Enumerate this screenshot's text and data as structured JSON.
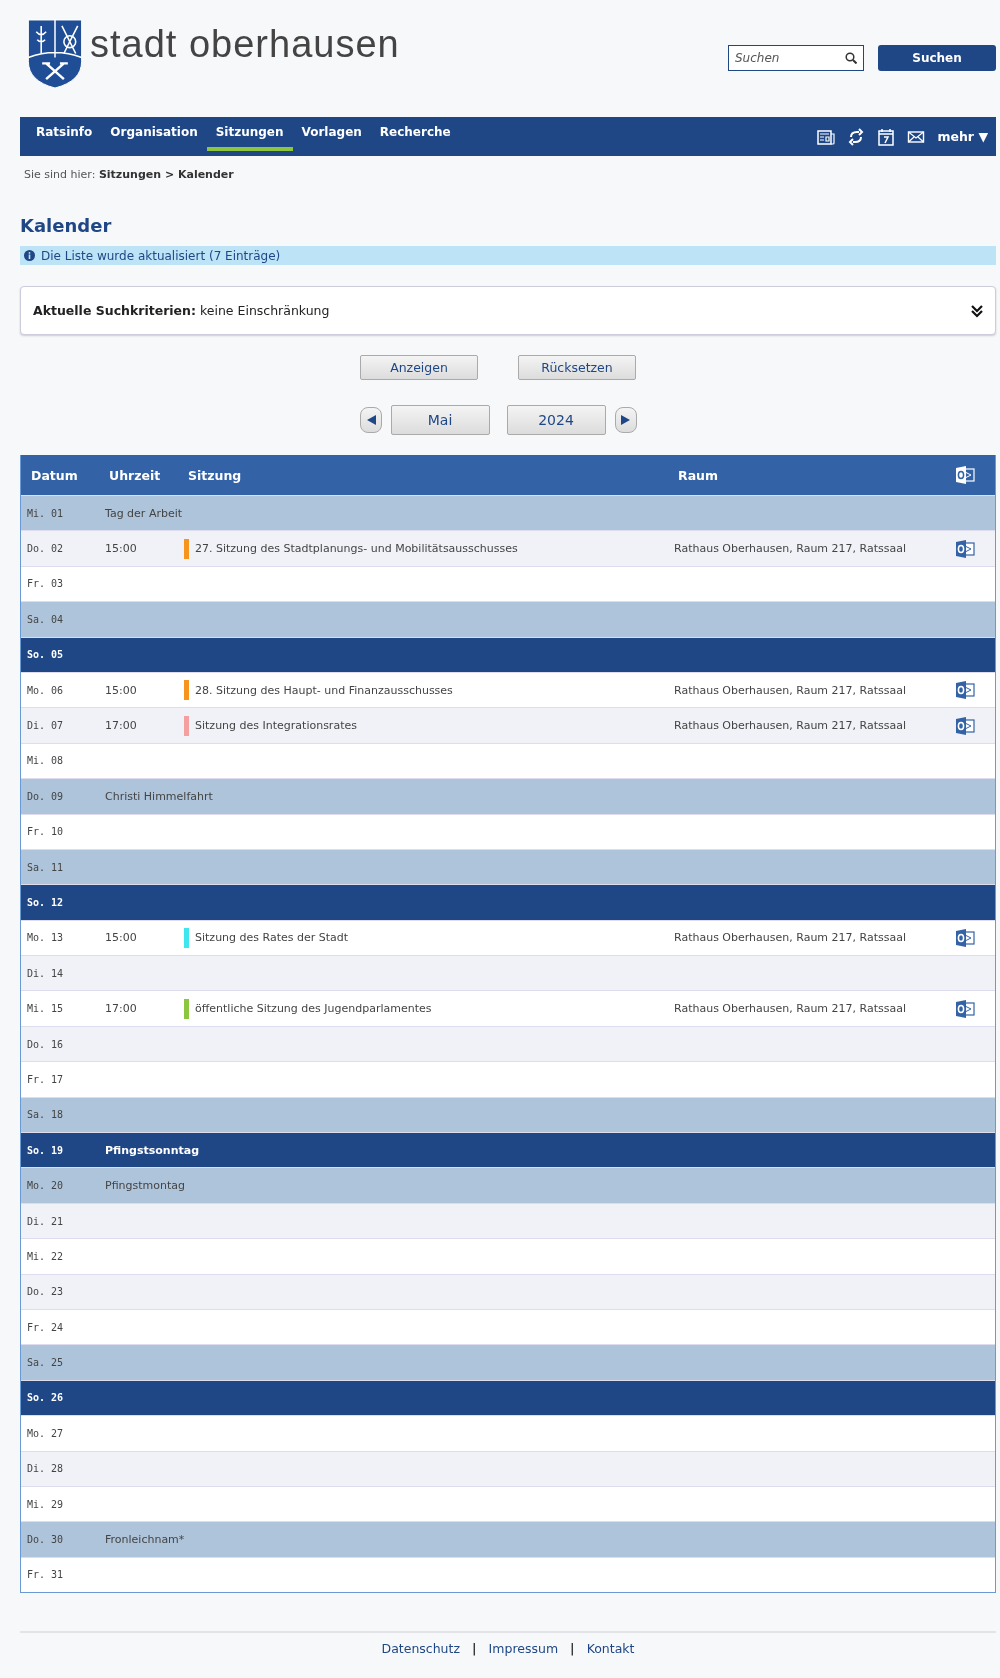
{
  "header": {
    "logo_text": "stadt oberhausen",
    "search": {
      "placeholder": "Suchen"
    },
    "search_button": "Suchen"
  },
  "nav": {
    "tabs": [
      {
        "label": "Ratsinfo",
        "selected": false
      },
      {
        "label": "Organisation",
        "selected": false
      },
      {
        "label": "Sitzungen",
        "selected": true
      },
      {
        "label": "Vorlagen",
        "selected": false
      },
      {
        "label": "Recherche",
        "selected": false
      }
    ],
    "more": "mehr ▼"
  },
  "breadcrumb": {
    "prefix": "Sie sind hier:",
    "path": "Sitzungen > Kalender"
  },
  "title": "Kalender",
  "notice": "Die Liste wurde aktualisiert (7 Einträge)",
  "criteria": {
    "label": "Aktuelle Suchkriterien:",
    "value": "keine Einschränkung"
  },
  "buttons": [
    "Anzeigen",
    "Rücksetzen"
  ],
  "period": {
    "month": "Mai",
    "year": "2024"
  },
  "table": {
    "columns": [
      "Datum",
      "Uhrzeit",
      "Sitzung",
      "Raum"
    ],
    "rows": [
      {
        "date": "Mi. 01",
        "kind": "holiday",
        "note": "Tag der Arbeit"
      },
      {
        "date": "Do. 02",
        "kind": "alt",
        "time": "15:00",
        "title": "27. Sitzung des Stadtplanungs- und Mobilitätsausschusses",
        "color": "#f7941d",
        "room": "Rathaus Oberhausen, Raum 217, Ratssaal"
      },
      {
        "date": "Fr. 03",
        "kind": "plain"
      },
      {
        "date": "Sa. 04",
        "kind": "holiday"
      },
      {
        "date": "So. 05",
        "kind": "sunday"
      },
      {
        "date": "Mo. 06",
        "kind": "plain",
        "time": "15:00",
        "title": "28. Sitzung des Haupt- und Finanzausschusses",
        "color": "#f7941d",
        "room": "Rathaus Oberhausen, Raum 217, Ratssaal"
      },
      {
        "date": "Di. 07",
        "kind": "alt",
        "time": "17:00",
        "title": "Sitzung des Integrationsrates",
        "color": "#f4a0a0",
        "room": "Rathaus Oberhausen, Raum 217, Ratssaal"
      },
      {
        "date": "Mi. 08",
        "kind": "plain"
      },
      {
        "date": "Do. 09",
        "kind": "holiday",
        "note": "Christi Himmelfahrt"
      },
      {
        "date": "Fr. 10",
        "kind": "plain"
      },
      {
        "date": "Sa. 11",
        "kind": "holiday"
      },
      {
        "date": "So. 12",
        "kind": "sunday"
      },
      {
        "date": "Mo. 13",
        "kind": "plain",
        "time": "15:00",
        "title": "Sitzung des Rates der Stadt",
        "color": "#3ee6f0",
        "room": "Rathaus Oberhausen, Raum 217, Ratssaal"
      },
      {
        "date": "Di. 14",
        "kind": "alt"
      },
      {
        "date": "Mi. 15",
        "kind": "plain",
        "time": "17:00",
        "title": "öffentliche Sitzung des Jugendparlamentes",
        "color": "#8cc63f",
        "room": "Rathaus Oberhausen, Raum 217, Ratssaal"
      },
      {
        "date": "Do. 16",
        "kind": "alt"
      },
      {
        "date": "Fr. 17",
        "kind": "plain"
      },
      {
        "date": "Sa. 18",
        "kind": "holiday"
      },
      {
        "date": "So. 19",
        "kind": "sunday",
        "note": "Pfingstsonntag"
      },
      {
        "date": "Mo. 20",
        "kind": "holiday",
        "note": "Pfingstmontag"
      },
      {
        "date": "Di. 21",
        "kind": "alt"
      },
      {
        "date": "Mi. 22",
        "kind": "plain"
      },
      {
        "date": "Do. 23",
        "kind": "alt"
      },
      {
        "date": "Fr. 24",
        "kind": "plain"
      },
      {
        "date": "Sa. 25",
        "kind": "holiday"
      },
      {
        "date": "So. 26",
        "kind": "sunday"
      },
      {
        "date": "Mo. 27",
        "kind": "plain"
      },
      {
        "date": "Di. 28",
        "kind": "alt"
      },
      {
        "date": "Mi. 29",
        "kind": "plain"
      },
      {
        "date": "Do. 30",
        "kind": "holiday",
        "note": "Fronleichnam*"
      },
      {
        "date": "Fr. 31",
        "kind": "plain"
      }
    ]
  },
  "footer": [
    {
      "kind": "link",
      "text": "Datenschutz"
    },
    {
      "kind": "separator",
      "text": "|"
    },
    {
      "kind": "link",
      "text": "Impressum"
    },
    {
      "kind": "separator",
      "text": "|"
    },
    {
      "kind": "link",
      "text": "Kontakt"
    }
  ]
}
